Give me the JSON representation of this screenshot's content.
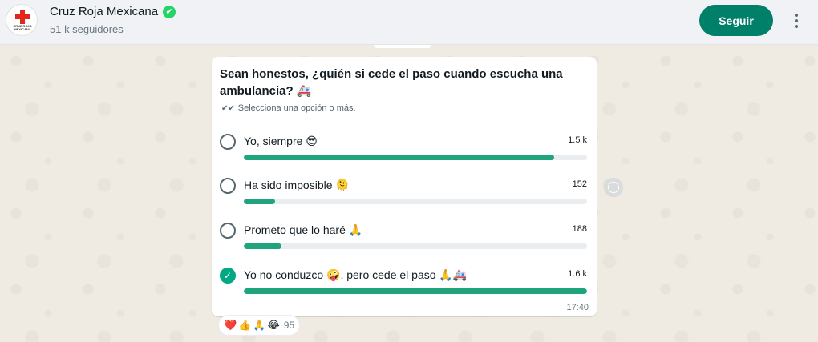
{
  "header": {
    "channel_name": "Cruz Roja Mexicana",
    "verified_icon": "✔",
    "followers": "51 k seguidores",
    "follow_label": "Seguir",
    "menu_icon": "more-vertical-icon",
    "logo_text": "CRUZ ROJA MEXICANA"
  },
  "poll": {
    "question": "Sean honestos, ¿quién si cede el paso cuando escucha una ambulancia? 🚑",
    "hint": "Selecciona una opción o más.",
    "options": [
      {
        "label": "Yo, siempre 😎",
        "count": "1.5 k",
        "fraction": 0.905,
        "selected": false
      },
      {
        "label": "Ha sido imposible 🫠",
        "count": "152",
        "fraction": 0.09,
        "selected": false
      },
      {
        "label": "Prometo que lo haré 🙏",
        "count": "188",
        "fraction": 0.11,
        "selected": false
      },
      {
        "label": "Yo no conduzco 🤪, pero cede el paso 🙏🚑",
        "count": "1.6 k",
        "fraction": 1.0,
        "selected": true
      }
    ],
    "timestamp": "17:40"
  },
  "reactions": {
    "emojis": [
      "❤️",
      "👍",
      "🙏",
      "😂"
    ],
    "count": "95"
  },
  "colors": {
    "accent": "#008069",
    "bar": "#1fa47d",
    "brand_red": "#e1261c"
  }
}
